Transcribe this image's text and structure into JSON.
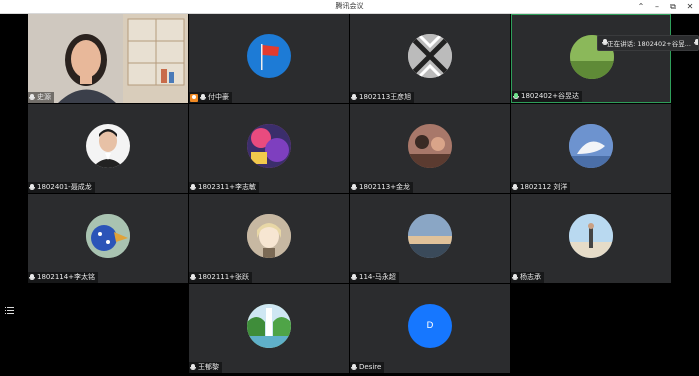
{
  "window": {
    "title": "腾讯会议",
    "buttons": {
      "pin": "⌃",
      "minimize": "–",
      "maximize": "⧉",
      "close": "✕"
    }
  },
  "speaking_indicator": {
    "text": "正在讲话: 1802402+谷昱..."
  },
  "participants": [
    {
      "name": "史源",
      "mic": "on",
      "avatar": "camera-video"
    },
    {
      "name": "付中豪",
      "mic": "on",
      "host": true,
      "avatar": "flag"
    },
    {
      "name": "1802113王彦旭",
      "mic": "on",
      "avatar": "bw-pattern"
    },
    {
      "name": "1802402+谷昱达",
      "mic": "active",
      "avatar": "green-field",
      "speaking": true
    },
    {
      "name": "1802401-聂成龙",
      "mic": "on",
      "avatar": "portrait-man"
    },
    {
      "name": "1802311+李志敏",
      "mic": "on",
      "avatar": "colorful"
    },
    {
      "name": "1802113+金龙",
      "mic": "on",
      "avatar": "crowd"
    },
    {
      "name": "1802112 刘洋",
      "mic": "on",
      "avatar": "whale"
    },
    {
      "name": "1802114+李太铭",
      "mic": "on",
      "avatar": "bird"
    },
    {
      "name": "1802111+张跃",
      "mic": "on",
      "avatar": "anime"
    },
    {
      "name": "114-马永超",
      "mic": "on",
      "avatar": "sky"
    },
    {
      "name": "杨志承",
      "mic": "on",
      "avatar": "beach"
    },
    {
      "name": "王郁黎",
      "mic": "on",
      "avatar": "waterfall"
    },
    {
      "name": "Desire",
      "mic": "on",
      "avatar": "letter",
      "letter": "D",
      "color": "#1677ff"
    }
  ],
  "colors": {
    "tile_bg": "#2b2c2e",
    "speaking_border": "#2f9e5a",
    "host_badge": "#f08a24"
  }
}
